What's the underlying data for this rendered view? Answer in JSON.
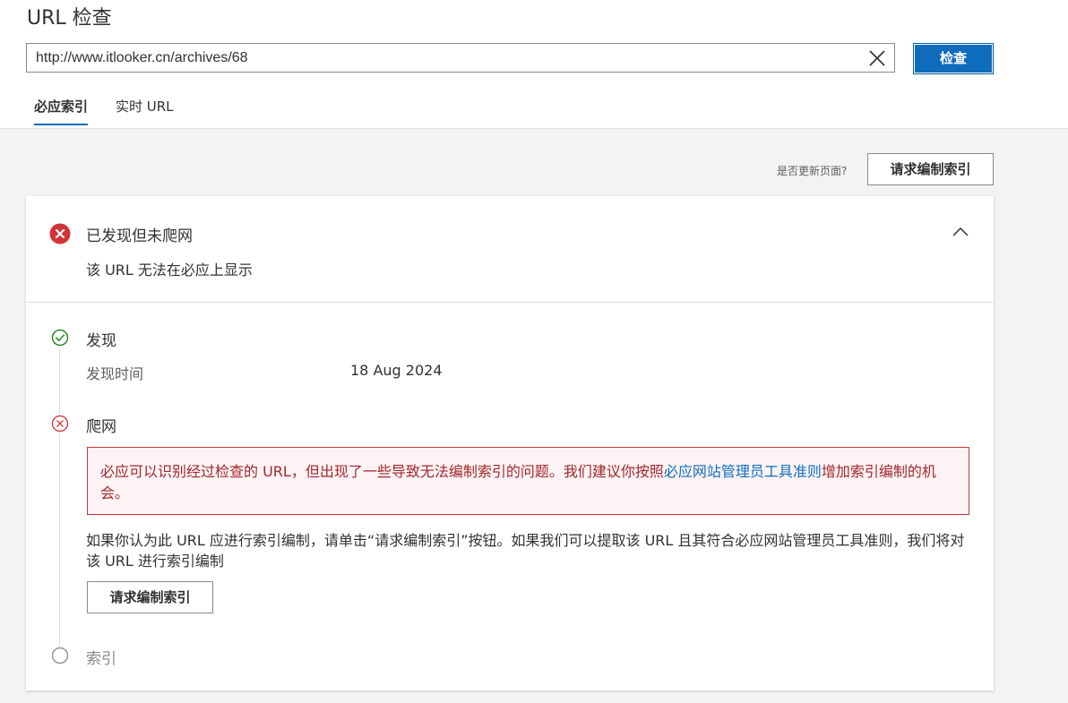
{
  "header": {
    "title": "URL 检查",
    "url_value": "http://www.itlooker.cn/archives/68",
    "inspect_label": "检查",
    "tabs": [
      {
        "label": "必应索引",
        "active": true
      },
      {
        "label": "实时 URL",
        "active": false
      }
    ]
  },
  "toolbar": {
    "updated_question": "是否更新页面?",
    "request_label": "请求编制索引"
  },
  "status": {
    "icon": "error-circle-icon",
    "title": "已发现但未爬网",
    "subtitle": "该 URL 无法在必应上显示"
  },
  "steps": {
    "discovery": {
      "icon": "check-circle-icon",
      "title": "发现",
      "date_label": "发现时间",
      "date_value": "18 Aug 2024"
    },
    "crawl": {
      "icon": "error-circle-outline-icon",
      "title": "爬网",
      "error_text_before": "必应可以识别经过检查的 URL，但出现了一些导致无法编制索引的问题。我们建议你按照",
      "error_link": "必应网站管理员工具准则",
      "error_text_after": "增加索引编制的机会。",
      "note": "如果你认为此 URL 应进行索引编制，请单击“请求编制索引”按钮。如果我们可以提取该 URL 且其符合必应网站管理员工具准则，我们将对该 URL 进行索引编制",
      "request_label": "请求编制索引"
    },
    "index": {
      "icon": "empty-circle-icon",
      "title": "索引"
    }
  },
  "colors": {
    "accent": "#0f6cbd",
    "error": "#d13438",
    "success": "#107c10"
  }
}
